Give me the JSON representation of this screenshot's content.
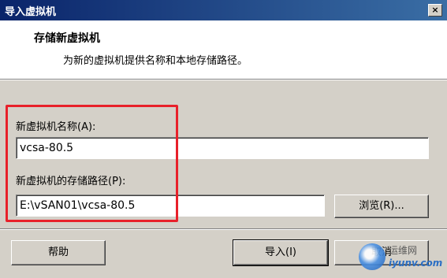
{
  "window": {
    "title": "导入虚拟机",
    "close_label": "×"
  },
  "header": {
    "title": "存储新虚拟机",
    "subtitle": "为新的虚拟机提供名称和本地存储路径。"
  },
  "form": {
    "name_label": "新虚拟机名称(A):",
    "name_value": "vcsa-80.5",
    "path_label": "新虚拟机的存储路径(P):",
    "path_value": "E:\\vSAN01\\vcsa-80.5",
    "browse_label": "浏览(R)..."
  },
  "footer": {
    "help_label": "帮助",
    "import_label": "导入(I)",
    "cancel_label": "取消"
  },
  "watermark": {
    "line1": "运维网",
    "line2": "iyunv.com"
  },
  "colors": {
    "highlight": "#e8202a",
    "titlebar_start": "#0a246a",
    "titlebar_end": "#3a6ea5"
  }
}
